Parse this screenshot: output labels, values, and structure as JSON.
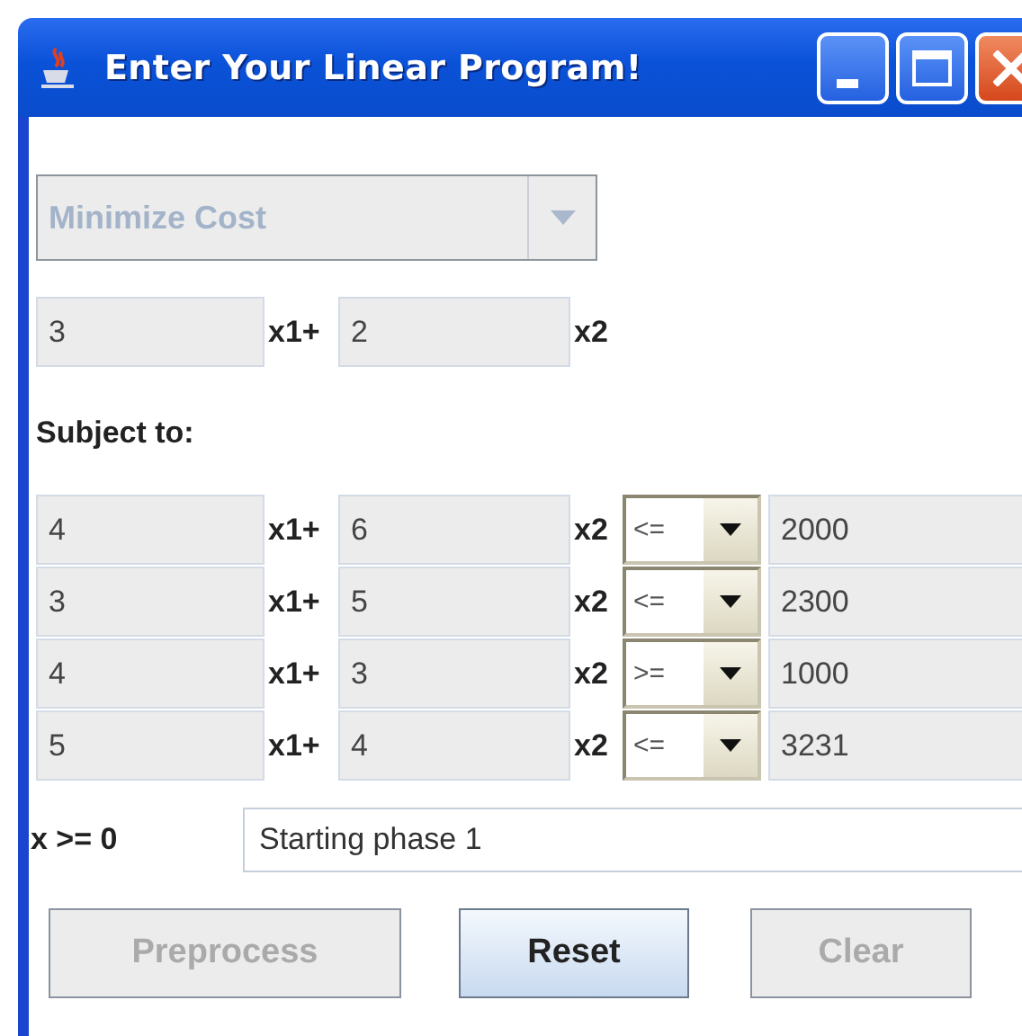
{
  "window": {
    "title": "Enter Your Linear Program!"
  },
  "objective": {
    "goal": {
      "value": "Minimize Cost",
      "disabled": true
    },
    "coefficients": [
      "3",
      "2"
    ],
    "terms": [
      "x1+",
      "x2"
    ]
  },
  "subject_label": "Subject to:",
  "constraints": [
    {
      "coefficients": [
        "4",
        "6"
      ],
      "terms": [
        "x1+",
        "x2"
      ],
      "relation": "<=",
      "rhs": "2000"
    },
    {
      "coefficients": [
        "3",
        "5"
      ],
      "terms": [
        "x1+",
        "x2"
      ],
      "relation": "<=",
      "rhs": "2300"
    },
    {
      "coefficients": [
        "4",
        "3"
      ],
      "terms": [
        "x1+",
        "x2"
      ],
      "relation": ">=",
      "rhs": "1000"
    },
    {
      "coefficients": [
        "5",
        "4"
      ],
      "terms": [
        "x1+",
        "x2"
      ],
      "relation": "<=",
      "rhs": "3231"
    }
  ],
  "nonnegativity": "x >= 0",
  "status": "Starting phase 1",
  "buttons": [
    {
      "label": "Preprocess",
      "disabled": true,
      "focused": false
    },
    {
      "label": "Reset",
      "disabled": false,
      "focused": true
    },
    {
      "label": "Clear",
      "disabled": true,
      "focused": false
    }
  ]
}
